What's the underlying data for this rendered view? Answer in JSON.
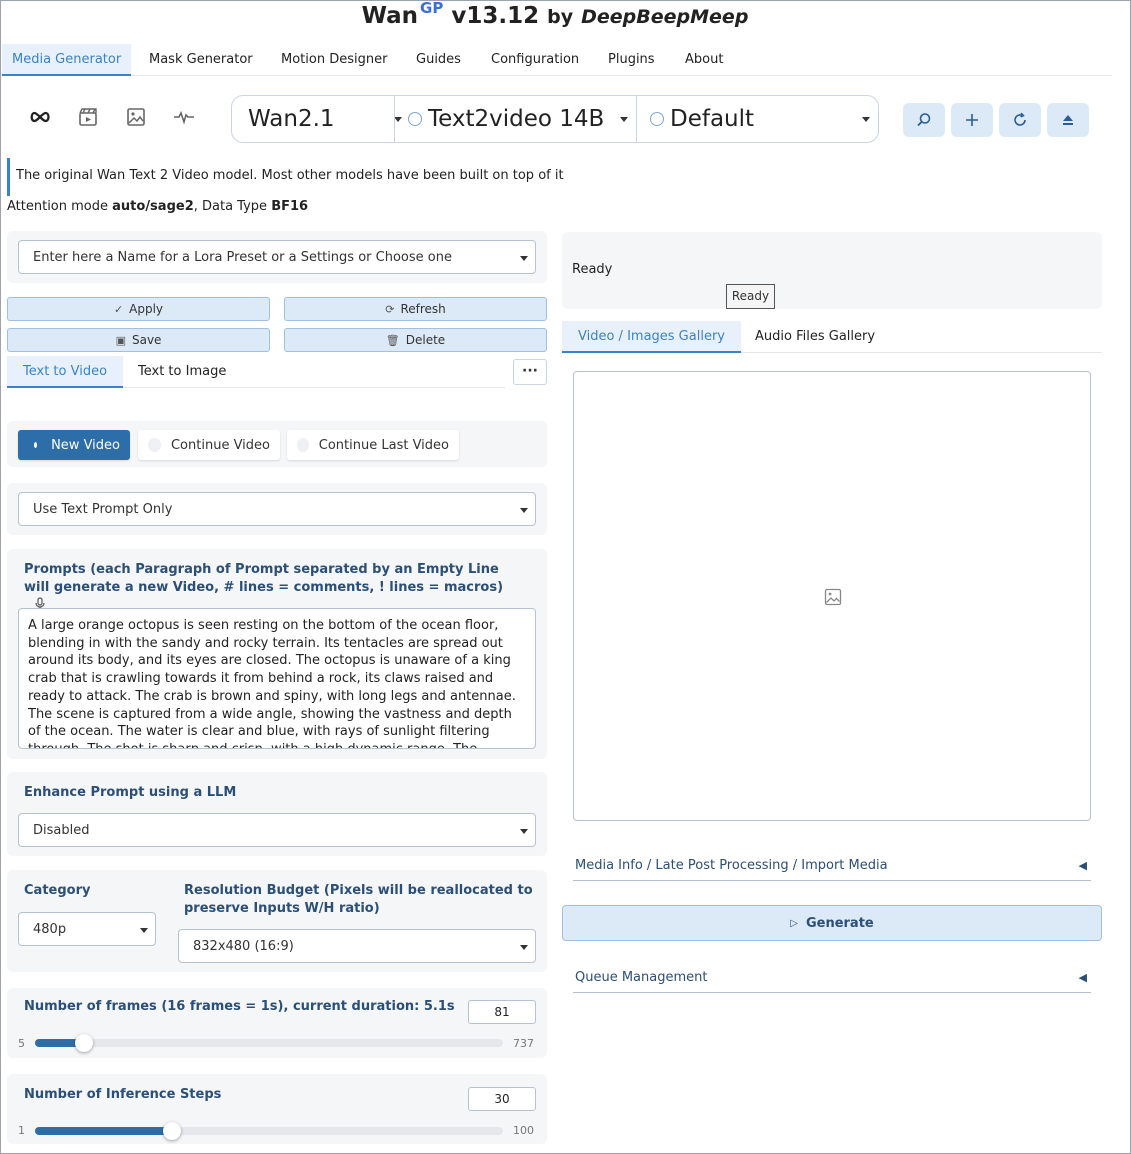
{
  "header": {
    "app_name": "Wan",
    "superscript": "GP",
    "version": "v13.12",
    "by": "by",
    "author": "DeepBeepMeep"
  },
  "nav_tabs": [
    {
      "label": "Media Generator"
    },
    {
      "label": "Mask Generator"
    },
    {
      "label": "Motion Designer"
    },
    {
      "label": "Guides"
    },
    {
      "label": "Configuration"
    },
    {
      "label": "Plugins"
    },
    {
      "label": "About"
    }
  ],
  "mode_icons": [
    "infinity-icon",
    "clapperboard-icon",
    "image-icon",
    "waveform-icon"
  ],
  "model_selector": {
    "family": "Wan2.1",
    "model": "Text2video 14B",
    "profile": "Default"
  },
  "model_description": "The original Wan Text 2 Video model. Most other models have been built on top of it",
  "attention": {
    "prefix": "Attention mode ",
    "mode": "auto/sage2",
    "middle": ", Data Type ",
    "dtype": "BF16"
  },
  "lora_preset": {
    "placeholder": "Enter here a Name for a Lora Preset or a Settings or Choose one"
  },
  "preset_buttons": {
    "apply": "Apply",
    "refresh": "Refresh",
    "save": "Save",
    "delete": "Delete"
  },
  "sub_tabs": [
    {
      "label": "Text to Video"
    },
    {
      "label": "Text to Image"
    }
  ],
  "more_label": "···",
  "video_mode": {
    "options": [
      "New Video",
      "Continue Video",
      "Continue Last Video"
    ],
    "selected": "New Video"
  },
  "prompt_type": "Use Text Prompt Only",
  "prompts": {
    "label": "Prompts (each Paragraph of Prompt separated by an Empty Line will generate a new Video, # lines = comments, ! lines = macros)",
    "text": "A large orange octopus is seen resting on the bottom of the ocean floor, blending in with the sandy and rocky terrain. Its tentacles are spread out around its body, and its eyes are closed. The octopus is unaware of a king crab that is crawling towards it from behind a rock, its claws raised and ready to attack. The crab is brown and spiny, with long legs and antennae. The scene is captured from a wide angle, showing the vastness and depth of the ocean. The water is clear and blue, with rays of sunlight filtering through. The shot is sharp and crisp, with a high dynamic range. The octopus and the crab are in focus, while the background is slightly blurred, creating a depth of field effect."
  },
  "enhance_prompt": {
    "label": "Enhance Prompt using a LLM",
    "value": "Disabled"
  },
  "category": {
    "label": "Category",
    "value": "480p"
  },
  "resolution": {
    "label": "Resolution Budget (Pixels will be reallocated to preserve Inputs W/H ratio)",
    "value": "832x480 (16:9)"
  },
  "frames": {
    "label": "Number of frames (16 frames = 1s), current duration: 5.1s",
    "value": 81,
    "min": 5,
    "max": 737
  },
  "steps": {
    "label": "Number of Inference Steps",
    "value": 30,
    "min": 1,
    "max": 100
  },
  "status": {
    "text": "Ready",
    "tooltip": "Ready"
  },
  "gallery_tabs": [
    {
      "label": "Video / Images Gallery"
    },
    {
      "label": "Audio Files Gallery"
    }
  ],
  "media_info": "Media Info / Late Post Processing / Import Media",
  "generate_label": "Generate",
  "queue_label": "Queue Management",
  "colors": {
    "accent": "#3b82c4",
    "button_bg": "#dceaf8",
    "selected_radio": "#2e6ea8",
    "label": "#2b4f77"
  }
}
